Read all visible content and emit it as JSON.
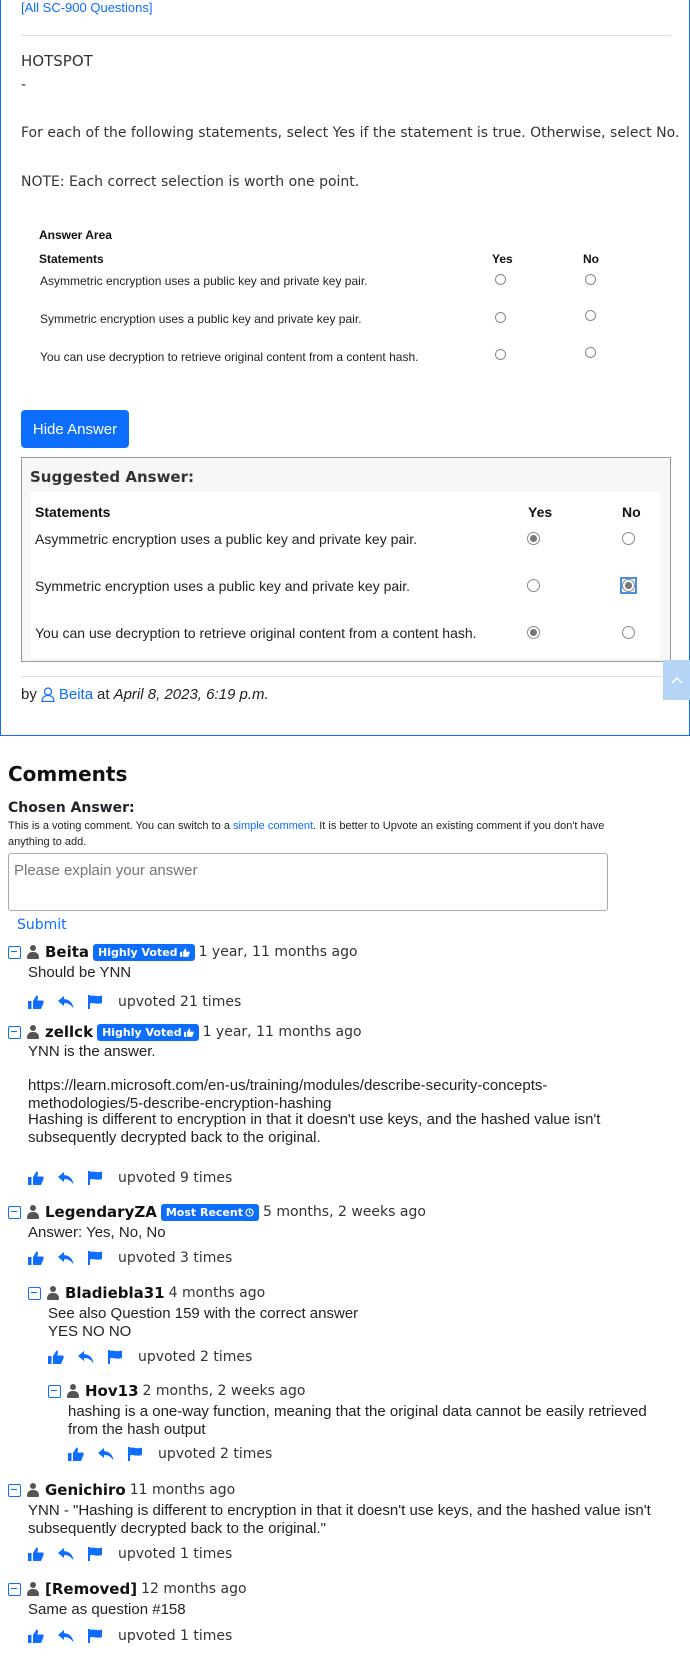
{
  "question": {
    "all_link": "[All SC-900 Questions]",
    "type_label": "HOTSPOT",
    "dash": "-",
    "instruction": "For each of the following statements, select Yes if the statement is true. Otherwise, select No.",
    "note": "NOTE: Each correct selection is worth one point.",
    "answer_area": {
      "title": "Answer Area",
      "col_statements": "Statements",
      "col_yes": "Yes",
      "col_no": "No",
      "statements": [
        "Asymmetric encryption uses a public key and private key pair.",
        "Symmetric encryption uses a public key and private key pair.",
        "You can use decryption to retrieve original content from a content hash."
      ]
    },
    "hide_answer_label": "Hide Answer",
    "suggested": {
      "title": "Suggested Answer:",
      "col_statements": "Statements",
      "col_yes": "Yes",
      "col_no": "No",
      "statements": [
        "Asymmetric encryption uses a public key and private key pair.",
        "Symmetric encryption uses a public key and private key pair.",
        "You can use decryption to retrieve original content from a content hash."
      ],
      "answers": [
        "Yes",
        "No",
        "Yes"
      ]
    },
    "byline": {
      "by": "by",
      "author": "Beita",
      "at": "at",
      "date": "April 8, 2023, 6:19 p.m."
    }
  },
  "comments": {
    "title": "Comments",
    "chosen_answer_label": "Chosen Answer:",
    "vote_note_pre": "This is a voting comment. You can switch to a ",
    "vote_note_link": "simple comment",
    "vote_note_post": ". It is better to Upvote an existing comment if you don't have anything to add.",
    "placeholder": "Please explain your answer",
    "submit_label": "Submit",
    "items": [
      {
        "user": "Beita",
        "badge": "Highly Voted",
        "ago": "1 year, 11 months ago",
        "lines": [
          "Should be YNN"
        ],
        "votes": "upvoted 21 times"
      },
      {
        "user": "zellck",
        "badge": "Highly Voted",
        "ago": "1 year, 11 months ago",
        "lines": [
          "YNN is the answer.",
          "",
          "https://learn.microsoft.com/en-us/training/modules/describe-security-concepts-methodologies/5-describe-encryption-hashing",
          "Hashing is different to encryption in that it doesn't use keys, and the hashed value isn't subsequently decrypted back to the original."
        ],
        "votes": "upvoted 9 times"
      },
      {
        "user": "LegendaryZA",
        "badge": "Most Recent",
        "ago": "5 months, 2 weeks ago",
        "lines": [
          "Answer: Yes, No, No"
        ],
        "votes": "upvoted 3 times"
      },
      {
        "user": "Bladiebla31",
        "badge": "",
        "ago": "4 months ago",
        "lines": [
          "See also Question 159 with the correct answer",
          "YES NO NO"
        ],
        "votes": "upvoted 2 times"
      },
      {
        "user": "Hov13",
        "badge": "",
        "ago": "2 months, 2 weeks ago",
        "lines": [
          "hashing is a one-way function, meaning that the original data cannot be easily retrieved from the hash output"
        ],
        "votes": "upvoted 2 times"
      },
      {
        "user": "Genichiro",
        "badge": "",
        "ago": "11 months ago",
        "lines": [
          "YNN - \"Hashing is different to encryption in that it doesn't use keys, and the hashed value isn't subsequently decrypted back to the original.\""
        ],
        "votes": "upvoted 1 times"
      },
      {
        "user": "[Removed]",
        "badge": "",
        "ago": "12 months ago",
        "lines": [
          "Same as question #158"
        ],
        "votes": "upvoted 1 times"
      }
    ]
  },
  "colors": {
    "accent": "#0d6efd",
    "border": "#0d6efd"
  }
}
